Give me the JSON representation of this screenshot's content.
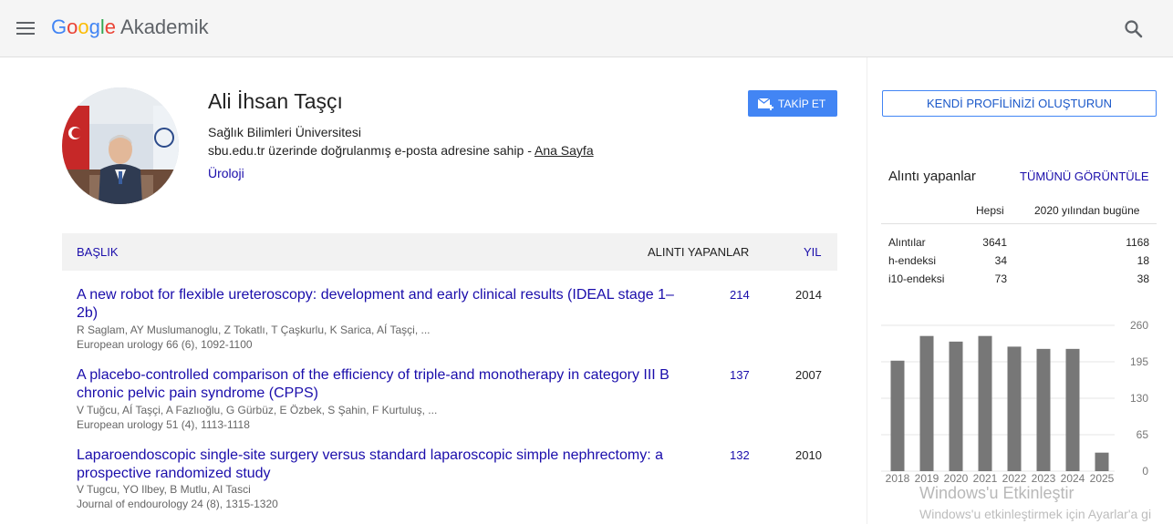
{
  "header": {
    "logo_letters": [
      "G",
      "o",
      "o",
      "g",
      "l",
      "e"
    ],
    "product": "Akademik"
  },
  "profile": {
    "name": "Ali İhsan Taşçı",
    "affiliation": "Sağlık Bilimleri Üniversitesi",
    "email_text": "sbu.edu.tr üzerinde doğrulanmış e-posta adresine sahip - ",
    "homepage_link": "Ana Sayfa",
    "interest": "Üroloji",
    "follow_label": "TAKİP ET"
  },
  "table": {
    "col_title": "BAŞLIK",
    "col_cited": "ALINTI YAPANLAR",
    "col_year": "YIL",
    "rows": [
      {
        "title": "A new robot for flexible ureteroscopy: development and early clinical results (IDEAL stage 1–2b)",
        "authors": "R Saglam, AY Muslumanoglu, Z Tokatlı, T Çaşkurlu, K Sarica, AÍ Taşçi, ...",
        "venue": "European urology 66 (6), 1092-1100",
        "cites": "214",
        "year": "2014"
      },
      {
        "title": "A placebo-controlled comparison of the efficiency of triple-and monotherapy in category III B chronic pelvic pain syndrome (CPPS)",
        "authors": "V Tuğcu, AÍ Taşçi, A Fazlıoğlu, G Gürbüz, E Özbek, S Şahin, F Kurtuluş, ...",
        "venue": "European urology 51 (4), 1113-1118",
        "cites": "137",
        "year": "2007"
      },
      {
        "title": "Laparoendoscopic single-site surgery versus standard laparoscopic simple nephrectomy: a prospective randomized study",
        "authors": "V Tugcu, YO Ilbey, B Mutlu, AI Tasci",
        "venue": "Journal of endourology 24 (8), 1315-1320",
        "cites": "132",
        "year": "2010"
      }
    ]
  },
  "sidebar": {
    "create_profile": "KENDİ PROFİLİNİZİ OLUŞTURUN",
    "cited_by": "Alıntı yapanlar",
    "view_all": "TÜMÜNÜ GÖRÜNTÜLE",
    "col_all": "Hepsi",
    "col_since": "2020 yılından bugüne",
    "stats": [
      {
        "label": "Alıntılar",
        "all": "3641",
        "since": "1168"
      },
      {
        "label": "h-endeksi",
        "all": "34",
        "since": "18"
      },
      {
        "label": "i10-endeksi",
        "all": "73",
        "since": "38"
      }
    ]
  },
  "chart_data": {
    "type": "bar",
    "categories": [
      "2018",
      "2019",
      "2020",
      "2021",
      "2022",
      "2023",
      "2024",
      "2025"
    ],
    "values": [
      197,
      241,
      231,
      241,
      222,
      218,
      218,
      33
    ],
    "yticks": [
      "0",
      "65",
      "130",
      "195",
      "260"
    ],
    "ylim": [
      0,
      260
    ],
    "bar_color": "#777777"
  },
  "watermark": {
    "line1": "Windows'u Etkinleştir",
    "line2": "Windows'u etkinleştirmek için Ayarlar'a gi"
  }
}
